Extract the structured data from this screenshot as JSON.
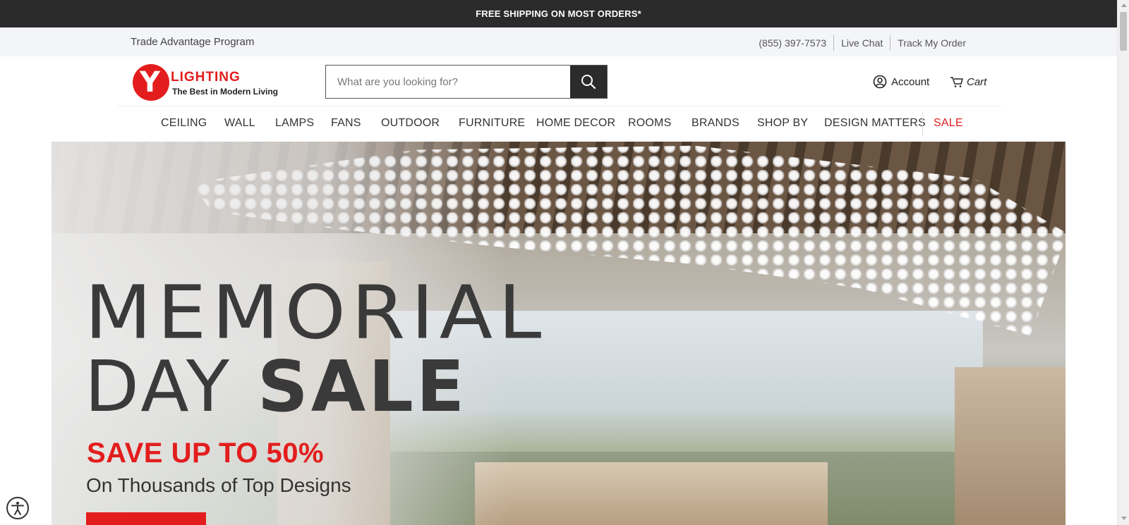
{
  "promo": {
    "text": "FREE SHIPPING ON MOST ORDERS*"
  },
  "utility": {
    "trade_program": "Trade Advantage Program",
    "phone": "(855) 397-7573",
    "live_chat": "Live Chat",
    "track_order": "Track My Order"
  },
  "logo": {
    "word": "LIGHTING",
    "tagline": "The Best in Modern Living",
    "letter": "Y",
    "brand_color": "#e31d1d"
  },
  "search": {
    "placeholder": "What are you looking for?",
    "icon": "search-icon"
  },
  "header": {
    "account_label": "Account",
    "cart_label": "Cart"
  },
  "nav": {
    "items": [
      "CEILING",
      "WALL",
      "LAMPS",
      "FANS",
      "OUTDOOR",
      "FURNITURE",
      "HOME DECOR",
      "ROOMS",
      "BRANDS",
      "SHOP BY",
      "DESIGN MATTERS",
      "SALE"
    ],
    "sale_color": "#e31d1d"
  },
  "hero": {
    "line1": "MEMORIAL",
    "line2_light": "DAY ",
    "line2_bold": "SALE",
    "save_text": "SAVE UP TO 50%",
    "subtitle": "On Thousands of Top Designs"
  },
  "colors": {
    "promo_bg": "#2b2b2b",
    "util_bg": "#f4f5f9",
    "accent": "#e31d1d"
  }
}
